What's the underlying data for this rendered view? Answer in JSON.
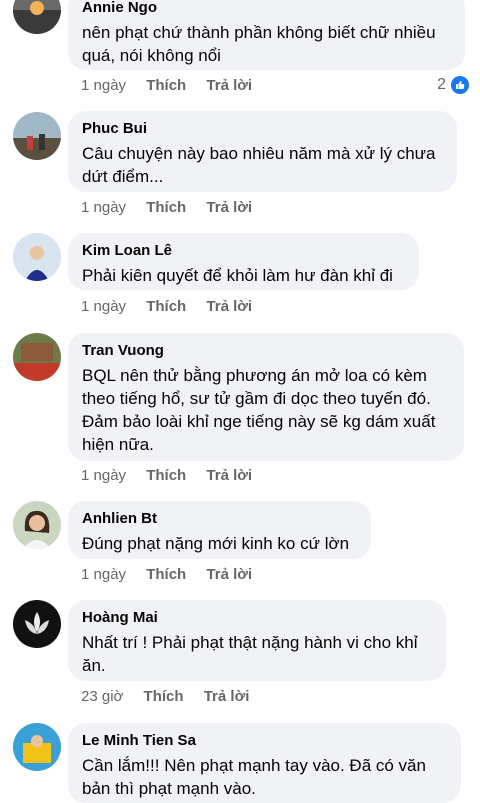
{
  "comments": [
    {
      "name": "Annie Ngo",
      "text": "nên phạt chứ thành phần không biết chữ nhiều quá, nói không nổi",
      "time": "1 ngày",
      "like": "Thích",
      "reply": "Trả lời",
      "reactions": "2"
    },
    {
      "name": "Phuc Bui",
      "text": "Câu chuyện này bao nhiêu năm mà xử lý chưa dứt điểm...",
      "time": "1 ngày",
      "like": "Thích",
      "reply": "Trả lời"
    },
    {
      "name": "Kim Loan Lê",
      "text": "Phải kiên quyết để khỏi làm hư đàn khỉ đi",
      "time": "1 ngày",
      "like": "Thích",
      "reply": "Trả lời"
    },
    {
      "name": "Tran Vuong",
      "text": "BQL nên thử bằng phương án mở loa có kèm theo tiếng hổ, sư tử gầm đi dọc theo tuyến đó. Đảm bảo loài khỉ nge tiếng này sẽ kg dám xuất hiện nữa.",
      "time": "1 ngày",
      "like": "Thích",
      "reply": "Trả lời"
    },
    {
      "name": "Anhlien Bt",
      "text": "Đúng phạt nặng mới kinh ko cứ lờn",
      "time": "1 ngày",
      "like": "Thích",
      "reply": "Trả lời"
    },
    {
      "name": "Hoàng Mai",
      "text": "Nhất trí ! Phải phạt thật nặng hành vi cho khỉ ăn.",
      "time": "23 giờ",
      "like": "Thích",
      "reply": "Trả lời"
    },
    {
      "name": "Le Minh Tien Sa",
      "text": "Cần lắm!!! Nên phạt mạnh tay vào. Đã có văn bản thì phạt mạnh vào.",
      "time": "",
      "like": "",
      "reply": ""
    }
  ]
}
